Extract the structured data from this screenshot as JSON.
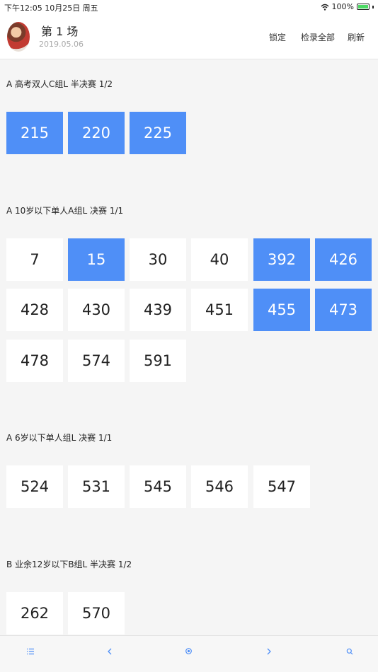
{
  "status": {
    "time_date": "下午12:05   10月25日 周五",
    "battery": "100%"
  },
  "header": {
    "title": "第 1 场",
    "date": "2019.05.06",
    "lock": "锁定",
    "check_all": "检录全部",
    "refresh": "刷新"
  },
  "groups": [
    {
      "label": "A 高考双人C组L 半决赛 1/2",
      "numbers": [
        "215",
        "220",
        "225"
      ]
    },
    {
      "label": "A 10岁以下单人A组L 决赛 1/1",
      "numbers": [
        "7",
        "15",
        "30",
        "40",
        "392",
        "426",
        "428",
        "430",
        "439",
        "451",
        "455",
        "473",
        "478",
        "574",
        "591"
      ]
    },
    {
      "label": "A 6岁以下单人组L 决赛 1/1",
      "numbers": [
        "524",
        "531",
        "545",
        "546",
        "547"
      ]
    },
    {
      "label": "B 业余12岁以下B组L 半决赛 1/2",
      "numbers": [
        "262",
        "570"
      ]
    }
  ],
  "colors": {
    "accent": "#4f8ff7"
  },
  "tabbar_icons": [
    "list-icon",
    "chevron-left-icon",
    "locate-icon",
    "chevron-right-icon",
    "search-icon"
  ]
}
